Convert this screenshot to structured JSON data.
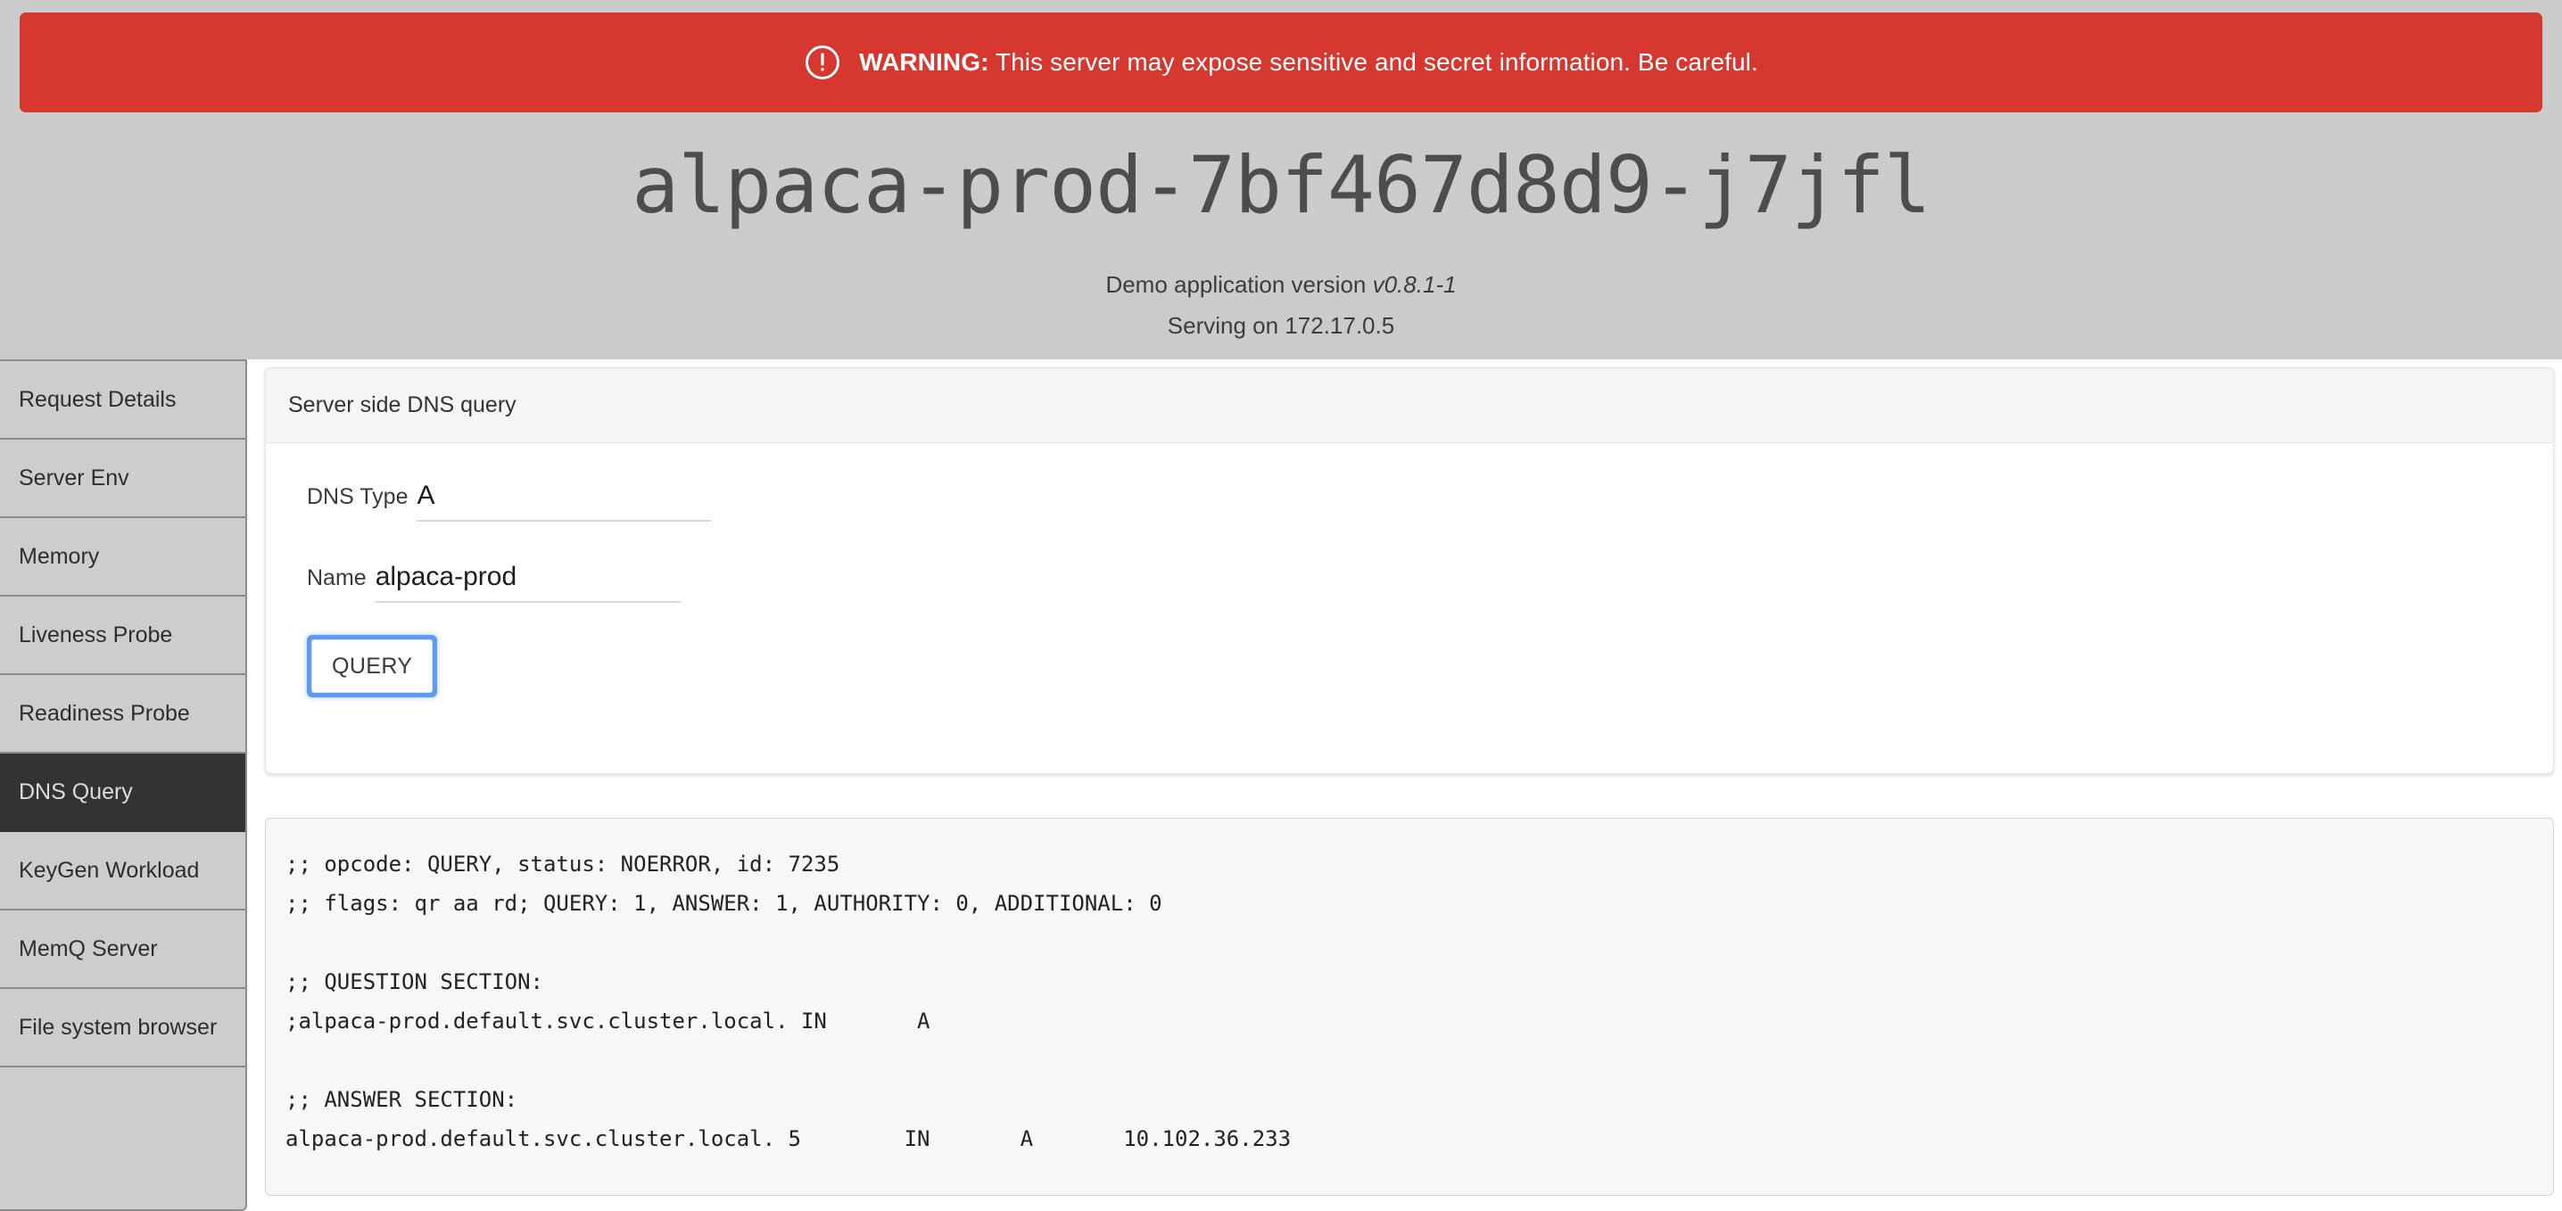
{
  "banner": {
    "icon": "alert-circle-icon",
    "label_bold": "WARNING:",
    "text": " This server may expose sensitive and secret information. Be careful.",
    "color": "#d6372e"
  },
  "header": {
    "title": "alpaca-prod-7bf467d8d9-j7jfl",
    "version_prefix": "Demo application version ",
    "version": "v0.8.1-1",
    "serving": "Serving on 172.17.0.5",
    "background": "#cbcbcb"
  },
  "sidebar": {
    "active": "DNS Query",
    "active_background": "#333333",
    "items": [
      {
        "label": "Request Details"
      },
      {
        "label": "Server Env"
      },
      {
        "label": "Memory"
      },
      {
        "label": "Liveness Probe"
      },
      {
        "label": "Readiness Probe"
      },
      {
        "label": "DNS Query"
      },
      {
        "label": "KeyGen Workload"
      },
      {
        "label": "MemQ Server"
      },
      {
        "label": "File system browser"
      }
    ]
  },
  "query_card": {
    "header": "Server side DNS query",
    "dns_type_label": "DNS Type",
    "dns_type_value": "A",
    "dns_type_placeholder": "",
    "name_label": "Name",
    "name_value": "alpaca-prod",
    "name_placeholder": "",
    "submit_label": "QUERY",
    "focus_color": "#5b9bf8"
  },
  "output": {
    "text": ";; opcode: QUERY, status: NOERROR, id: 7235\n;; flags: qr aa rd; QUERY: 1, ANSWER: 1, AUTHORITY: 0, ADDITIONAL: 0\n\n;; QUESTION SECTION:\n;alpaca-prod.default.svc.cluster.local.\tIN\t A\n\n;; ANSWER SECTION:\nalpaca-prod.default.svc.cluster.local. 5\tIN\t A\t 10.102.36.233"
  }
}
